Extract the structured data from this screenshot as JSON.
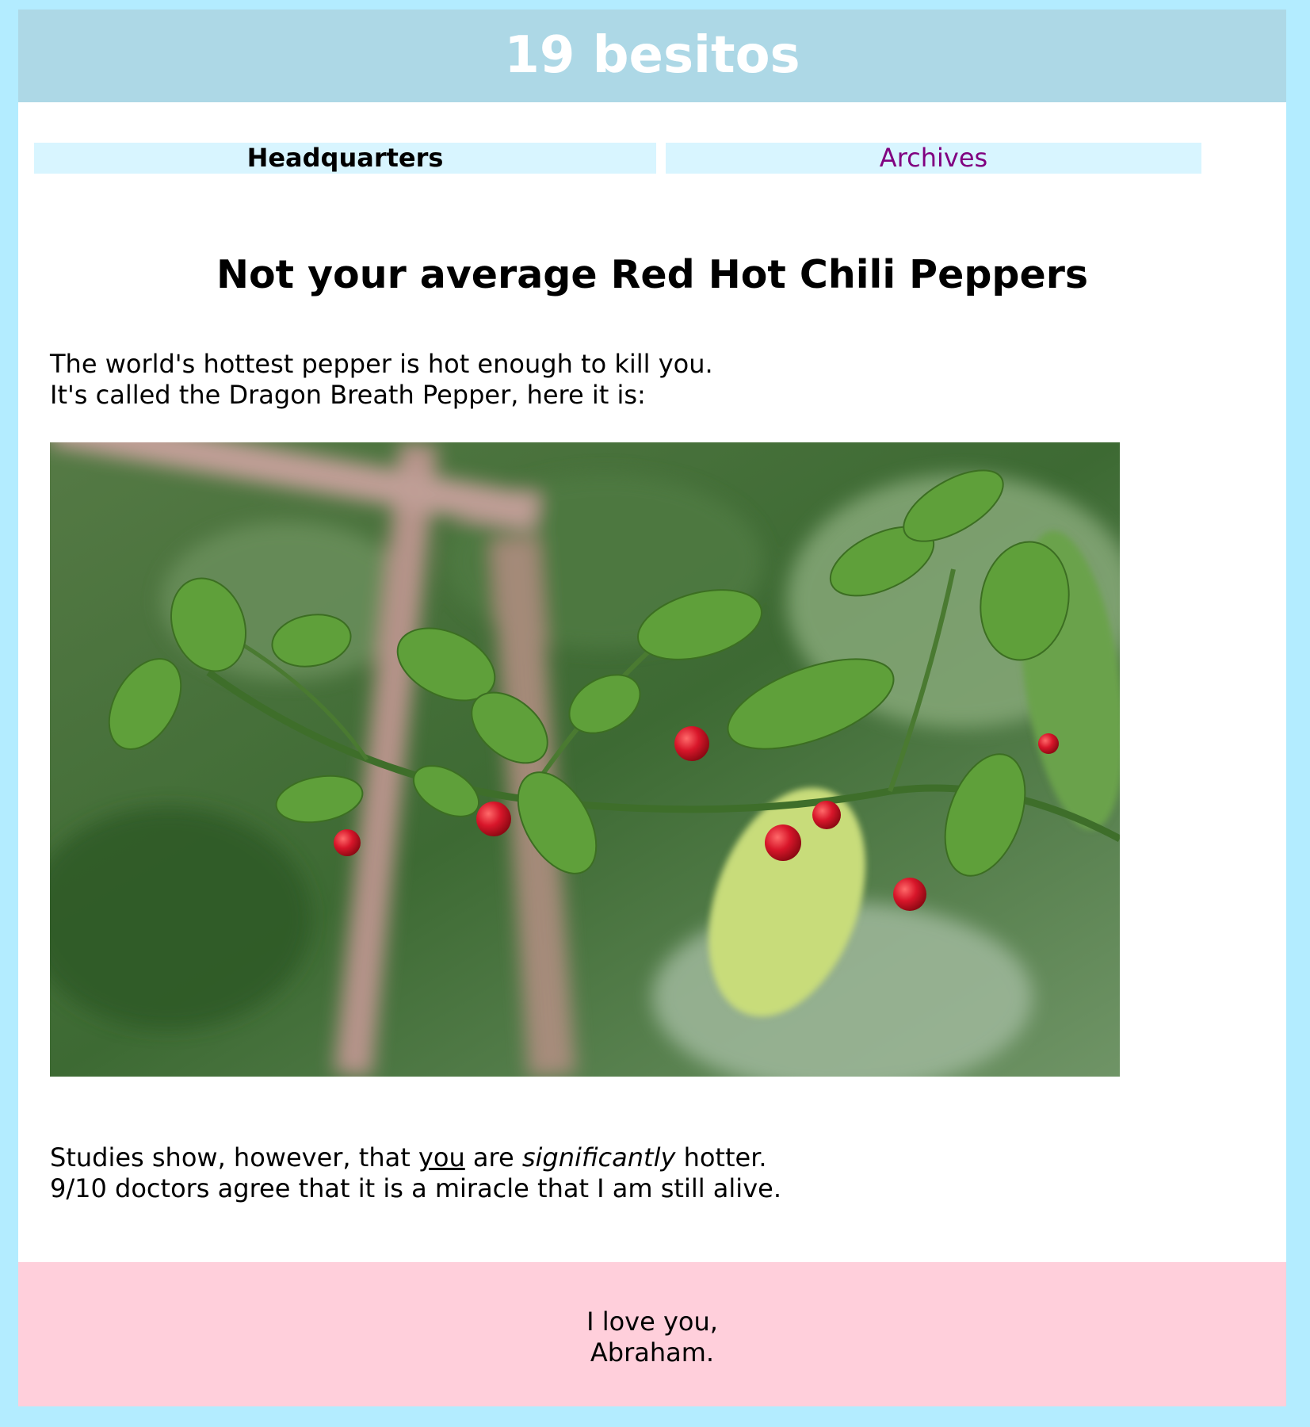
{
  "header": {
    "title": "19 besitos"
  },
  "nav": {
    "headquarters": "Headquarters",
    "archives": "Archives"
  },
  "post": {
    "title": "Not your average Red Hot Chili Peppers",
    "intro_line1": "The world's hottest pepper is hot enough to kill you.",
    "intro_line2": "It's called the Dragon Breath Pepper, here it is:",
    "outro_line1_a": "Studies show, however, that ",
    "outro_line1_you": "you",
    "outro_line1_b": " are ",
    "outro_line1_em": "significantly",
    "outro_line1_c": " hotter.",
    "outro_line2": "9/10 doctors agree that it is a miracle that I am still alive."
  },
  "footer": {
    "line1": "I love you,",
    "line2": "Abraham."
  },
  "colors": {
    "page_background": "#b3ecff",
    "header_background": "#add8e6",
    "nav_background": "#d8f5ff",
    "visited_link": "#800080",
    "footer_background": "#ffcfdb"
  }
}
